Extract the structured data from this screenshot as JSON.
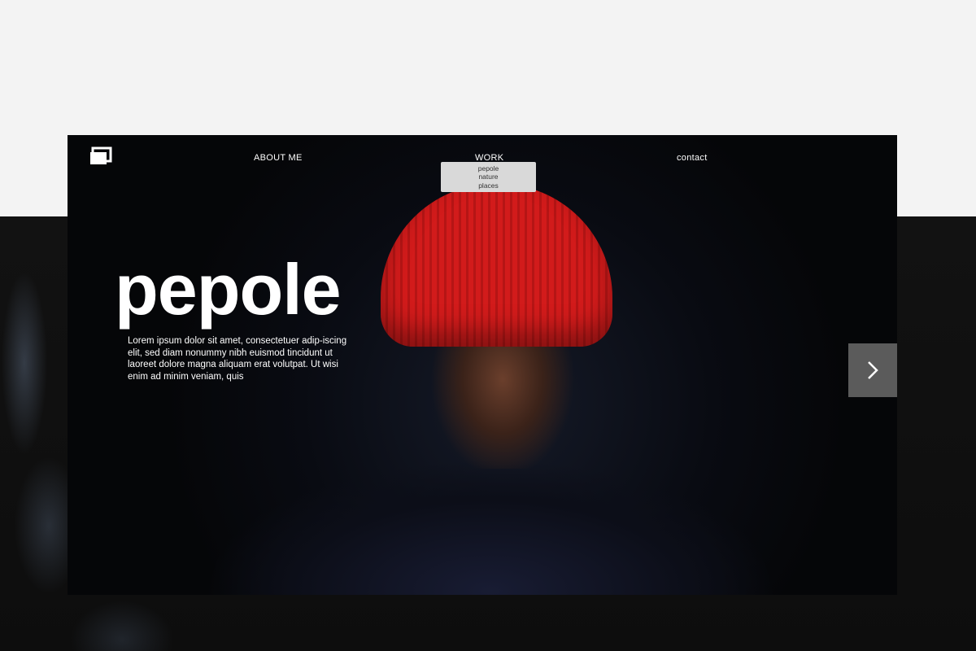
{
  "nav": {
    "about_label": "ABOUT ME",
    "work_label": "WORK",
    "contact_label": "contact"
  },
  "work_menu": [
    "pepole",
    "nature",
    "places"
  ],
  "hero": {
    "title": "pepole",
    "description": "Lorem ipsum dolor sit amet, consectetuer adip-iscing elit, sed diam nonummy nibh euismod tincidunt ut laoreet dolore magna aliquam erat volutpat. Ut wisi enim ad minim veniam, quis"
  },
  "icons": {
    "logo": "logo-icon",
    "next": "chevron-right-icon"
  },
  "colors": {
    "hat": "#d21b1b",
    "stage": "#090b12",
    "next_button": "#5b5b5b"
  }
}
